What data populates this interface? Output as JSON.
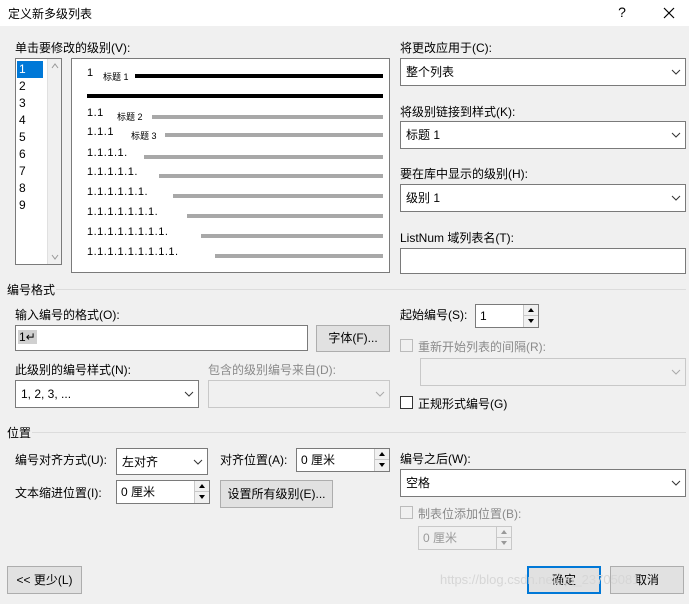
{
  "window": {
    "title": "定义新多级列表",
    "help": "?",
    "close": "✕"
  },
  "level_section": {
    "label": "单击要修改的级别(V):",
    "levels": [
      "1",
      "2",
      "3",
      "4",
      "5",
      "6",
      "7",
      "8",
      "9"
    ],
    "selected": "1",
    "preview": {
      "lines": [
        {
          "num": "1",
          "caption": "标题 1"
        },
        {
          "num": "1.1",
          "caption": "标题 2"
        },
        {
          "num": "1.1.1",
          "caption": "标题 3"
        },
        {
          "num": "1.1.1.1."
        },
        {
          "num": "1.1.1.1.1."
        },
        {
          "num": "1.1.1.1.1.1."
        },
        {
          "num": "1.1.1.1.1.1.1."
        },
        {
          "num": "1.1.1.1.1.1.1.1."
        },
        {
          "num": "1.1.1.1.1.1.1.1.1."
        }
      ]
    }
  },
  "apply_to": {
    "label": "将更改应用于(C):",
    "value": "整个列表"
  },
  "link_style": {
    "label": "将级别链接到样式(K):",
    "value": "标题 1"
  },
  "gallery_level": {
    "label": "要在库中显示的级别(H):",
    "value": "级别 1"
  },
  "listnum": {
    "label": "ListNum 域列表名(T):",
    "value": ""
  },
  "number_format": {
    "section_title": "编号格式",
    "format_label": "输入编号的格式(O):",
    "format_value": "1↵",
    "font_button": "字体(F)...",
    "start_label": "起始编号(S):",
    "start_value": "1",
    "restart_label": "重新开始列表的间隔(R):",
    "restart_value": "",
    "style_label": "此级别的编号样式(N):",
    "style_value": "1, 2, 3, ...",
    "include_label": "包含的级别编号来自(D):",
    "include_value": "",
    "legal_label": "正规形式编号(G)"
  },
  "position": {
    "section_title": "位置",
    "align_label": "编号对齐方式(U):",
    "align_value": "左对齐",
    "align_at_label": "对齐位置(A):",
    "align_at_value": "0 厘米",
    "indent_label": "文本缩进位置(I):",
    "indent_value": "0 厘米",
    "set_all_button": "设置所有级别(E)...",
    "follow_label": "编号之后(W):",
    "follow_value": "空格",
    "tab_stop_label": "制表位添加位置(B):",
    "tab_stop_value": "0 厘米"
  },
  "footer": {
    "less_button": "<< 更少(L)",
    "ok_button": "确定",
    "cancel_button": "取消",
    "watermark": "https://blog.csdn.net/qq_23705081"
  }
}
